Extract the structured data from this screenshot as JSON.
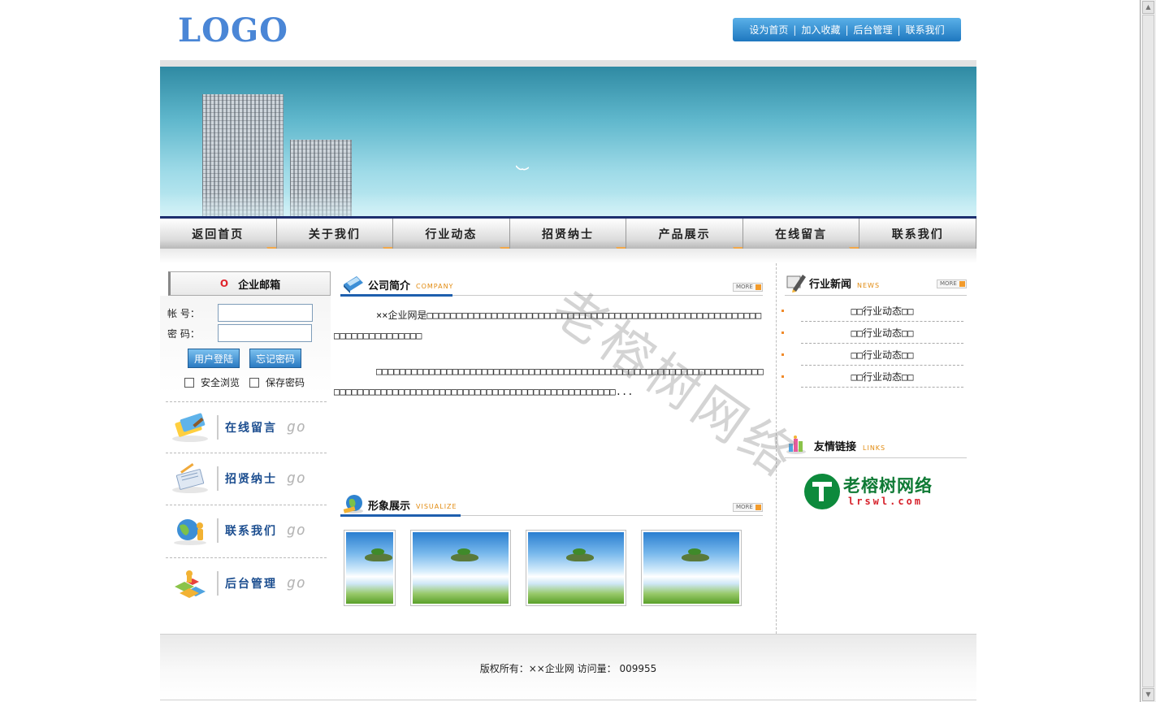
{
  "header": {
    "logo": "LOGO",
    "topnav": [
      "设为首页",
      "加入收藏",
      "后台管理",
      "联系我们"
    ],
    "separator": "|"
  },
  "nav": {
    "items": [
      "返回首页",
      "关于我们",
      "行业动态",
      "招贤纳士",
      "产品展示",
      "在线留言",
      "联系我们"
    ]
  },
  "login": {
    "title": "企业邮箱",
    "bullet": "O",
    "account_label": "帐 号：",
    "password_label": "密 码：",
    "account_value": "",
    "password_value": "",
    "login_button": "用户登陆",
    "forgot_button": "忘记密码",
    "safe_browse": "安全浏览",
    "save_password": "保存密码"
  },
  "quicklinks": [
    {
      "label": "在线留言",
      "icon": "message-board-icon",
      "go": "go"
    },
    {
      "label": "招贤纳士",
      "icon": "recruit-notepad-icon",
      "go": "go"
    },
    {
      "label": "联系我们",
      "icon": "globe-contact-icon",
      "go": "go"
    },
    {
      "label": "后台管理",
      "icon": "admin-blocks-icon",
      "go": "go"
    }
  ],
  "company": {
    "title": "公司简介",
    "subtitle": "COMPANY",
    "more": "MORE",
    "paragraph1": "××企业网是□□□□□□□□□□□□□□□□□□□□□□□□□□□□□□□□□□□□□□□□□□□□□□□□□□□□□□□□□□□□□□□□□□□□□□□□",
    "paragraph2": "□□□□□□□□□□□□□□□□□□□□□□□□□□□□□□□□□□□□□□□□□□□□□□□□□□□□□□□□□□□□□□□□□□□□□□□□□□□□□□□□□□□□□□□□□□□□□□□□□□□□□□□□□□□□□□□□□□..."
  },
  "gallery": {
    "title": "形象展示",
    "subtitle": "VISUALIZE",
    "more": "MORE"
  },
  "news": {
    "title": "行业新闻",
    "subtitle": "NEWS",
    "more": "MORE",
    "items": [
      "□□行业动态□□",
      "□□行业动态□□",
      "□□行业动态□□",
      "□□行业动态□□"
    ]
  },
  "links": {
    "title": "友情链接",
    "subtitle": "LINKS",
    "partner_name": "老榕树网络",
    "partner_url": "lrswl.com"
  },
  "footer": {
    "copyright": "版权所有：××企业网  访问量：  009955"
  },
  "watermark": "老榕树网络",
  "colors": {
    "logo": "#4a86d6",
    "nav_border": "#1d2f6f",
    "accent_orange": "#f2a84a",
    "link_blue": "#1b4d8f"
  }
}
